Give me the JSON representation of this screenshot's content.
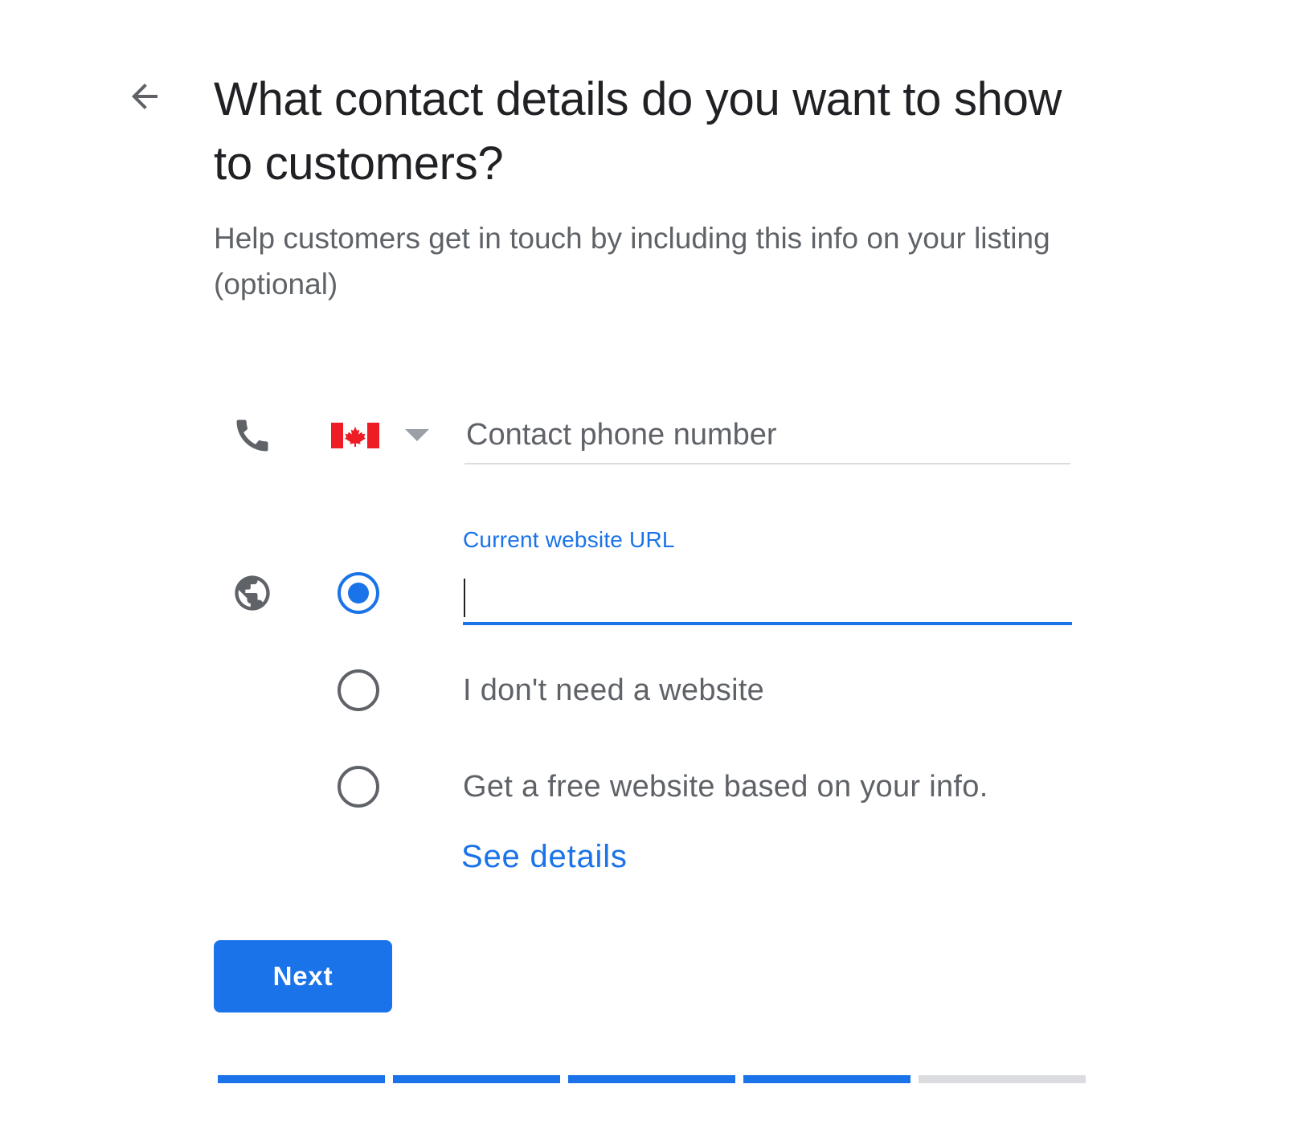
{
  "header": {
    "back_icon": "arrow-back-icon",
    "title": "What contact details do you want to show to customers?",
    "subtitle": "Help customers get in touch by including this info on your listing (optional)"
  },
  "phone": {
    "icon": "phone-icon",
    "country_flag": "canada-flag-icon",
    "caret_icon": "dropdown-caret-icon",
    "placeholder": "Contact phone number",
    "value": ""
  },
  "website": {
    "icon": "globe-icon",
    "url_label": "Current website URL",
    "url_value": "",
    "options": [
      {
        "label": "",
        "selected": true
      },
      {
        "label": "I don't need a website",
        "selected": false
      },
      {
        "label": "Get a free website based on your info.",
        "selected": false
      }
    ],
    "see_details": "See details"
  },
  "actions": {
    "next_label": "Next"
  },
  "progress": {
    "steps_total": 5,
    "steps_complete": 4
  },
  "colors": {
    "accent": "#1a73e8",
    "text_primary": "#202124",
    "text_secondary": "#5f6368",
    "divider": "#dadce0"
  }
}
